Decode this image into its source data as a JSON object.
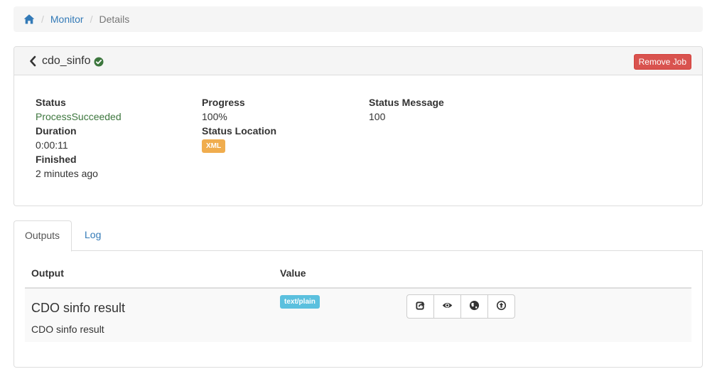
{
  "breadcrumb": {
    "home_icon": "home-icon",
    "items": [
      "Monitor",
      "Details"
    ],
    "separator": "/"
  },
  "job": {
    "name": "cdo_sinfo",
    "status_icon": "check-circle-icon",
    "remove_label": "Remove Job",
    "status_label": "Status",
    "status_value": "ProcessSucceeded",
    "duration_label": "Duration",
    "duration_value": "0:00:11",
    "finished_label": "Finished",
    "finished_value": "2 minutes ago",
    "progress_label": "Progress",
    "progress_value": "100%",
    "status_location_label": "Status Location",
    "status_location_badge": "XML",
    "status_message_label": "Status Message",
    "status_message_value": "100"
  },
  "tabs": [
    {
      "label": "Outputs",
      "active": true
    },
    {
      "label": "Log",
      "active": false
    }
  ],
  "outputs": {
    "columns": [
      "Output",
      "Value"
    ],
    "rows": [
      {
        "title": "CDO sinfo result",
        "description": "CDO sinfo result",
        "mime_type": "text/plain",
        "actions": [
          "share-icon",
          "eye-icon",
          "globe-icon",
          "upload-circle-icon"
        ]
      }
    ]
  },
  "colors": {
    "link": "#337ab7",
    "success": "#3c763d",
    "danger": "#d9534f",
    "warning": "#f0ad4e",
    "info": "#5bc0de"
  }
}
